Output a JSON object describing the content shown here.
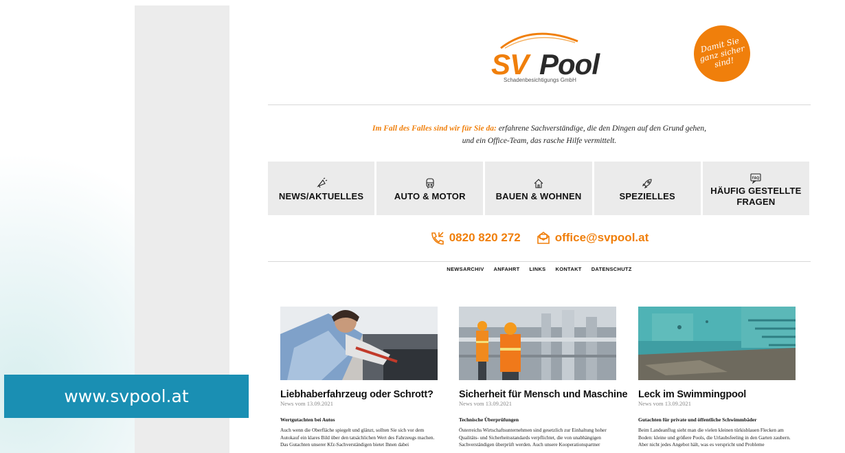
{
  "badge": {
    "url": "www.svpool.at"
  },
  "logo": {
    "sv": "SV",
    "pool": "Pool",
    "subtitle": "Schadenbesichtigungs GmbH"
  },
  "seal": {
    "line1": "Damit Sie",
    "line2": "ganz sicher",
    "line3": "sind!"
  },
  "tagline": {
    "highlight": "Im Fall des Falles sind wir für Sie da:",
    "rest": " erfahrene Sachverständige, die den Dingen auf den Grund gehen,",
    "line2": "und ein Office-Team, das rasche Hilfe vermittelt."
  },
  "tiles": [
    {
      "label": "NEWS/AKTUELLES",
      "icon": "megaphone-icon"
    },
    {
      "label": "AUTO & MOTOR",
      "icon": "car-icon"
    },
    {
      "label": "BAUEN & WOHNEN",
      "icon": "house-icon"
    },
    {
      "label": "SPEZIELLES",
      "icon": "rocket-icon"
    },
    {
      "label": "HÄUFIG GESTELLTE FRAGEN",
      "icon": "faq-icon",
      "icon_text": "FAQ"
    }
  ],
  "contact": {
    "phone": "0820 820 272",
    "email": "office@svpool.at"
  },
  "subnav": [
    "NEWSARCHIV",
    "ANFAHRT",
    "LINKS",
    "KONTAKT",
    "DATENSCHUTZ"
  ],
  "articles": [
    {
      "title": "Liebhaberfahrzeug oder Schrott?",
      "date": "News vom 13.09.2021",
      "subtitle": "Wertgutachten bei Autos",
      "body": "Auch wenn die Oberfläche spiegelt und glänzt, sollten Sie sich vor dem Autokauf ein klares Bild über den tatsächlichen Wert des Fahrzeugs machen. Das Gutachten unserer Kfz-Sachverständigen bietet Ihnen dabei"
    },
    {
      "title": "Sicherheit für Mensch und Maschine",
      "date": "News vom 13.09.2021",
      "subtitle": "Technische Überprüfungen",
      "body": "Österreichs Wirtschaftsunternehmen sind gesetzlich zur Einhaltung hoher Qualitäts- und Sicherheitsstandards verpflichtet, die von unabhängigen Sachverständigen überprüft werden. Auch unsere Kooperationspartner"
    },
    {
      "title": "Leck im Swimmingpool",
      "date": "News vom 13.09.2021",
      "subtitle": "Gutachten für private und öffentliche Schwimmbäder",
      "body": "Beim Landeanflug sieht man die vielen kleinen türkisblauen Flecken am Boden: kleine und größere Pools, die Urlaubsfeeling in den Garten zaubern. Aber nicht jedes Angebot hält, was es verspricht und Probleme"
    }
  ],
  "colors": {
    "accent": "#f07f0b",
    "badge": "#1a8fb3",
    "tile_bg": "#ebebeb"
  }
}
